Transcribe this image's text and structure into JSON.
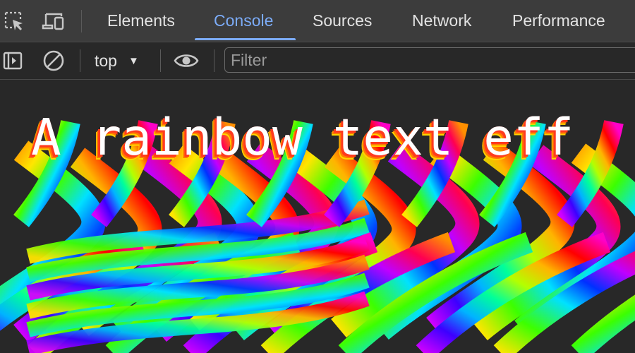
{
  "tabs": [
    {
      "label": "Elements",
      "active": false
    },
    {
      "label": "Console",
      "active": true
    },
    {
      "label": "Sources",
      "active": false
    },
    {
      "label": "Network",
      "active": false
    },
    {
      "label": "Performance",
      "active": false
    }
  ],
  "tabbar_icons": [
    "inspect-element-icon",
    "device-toolbar-icon"
  ],
  "toolbar": {
    "sidebar_icon": "show-sidebar-icon",
    "clear_icon": "clear-console-icon",
    "context": "top",
    "live_expression_icon": "eye-icon",
    "filter_placeholder": "Filter",
    "filter_value": ""
  },
  "console": {
    "message": "A rainbow text eff"
  },
  "colors": {
    "background": "#282828",
    "tabbar_bg": "#3c3c3c",
    "active_tab": "#7cacf8",
    "text": "#e3e3e3",
    "rainbow": [
      "#ff0000",
      "#ff7a00",
      "#ffe600",
      "#3cff00",
      "#00e1ff",
      "#0040ff",
      "#a000ff",
      "#ff00c8"
    ]
  }
}
